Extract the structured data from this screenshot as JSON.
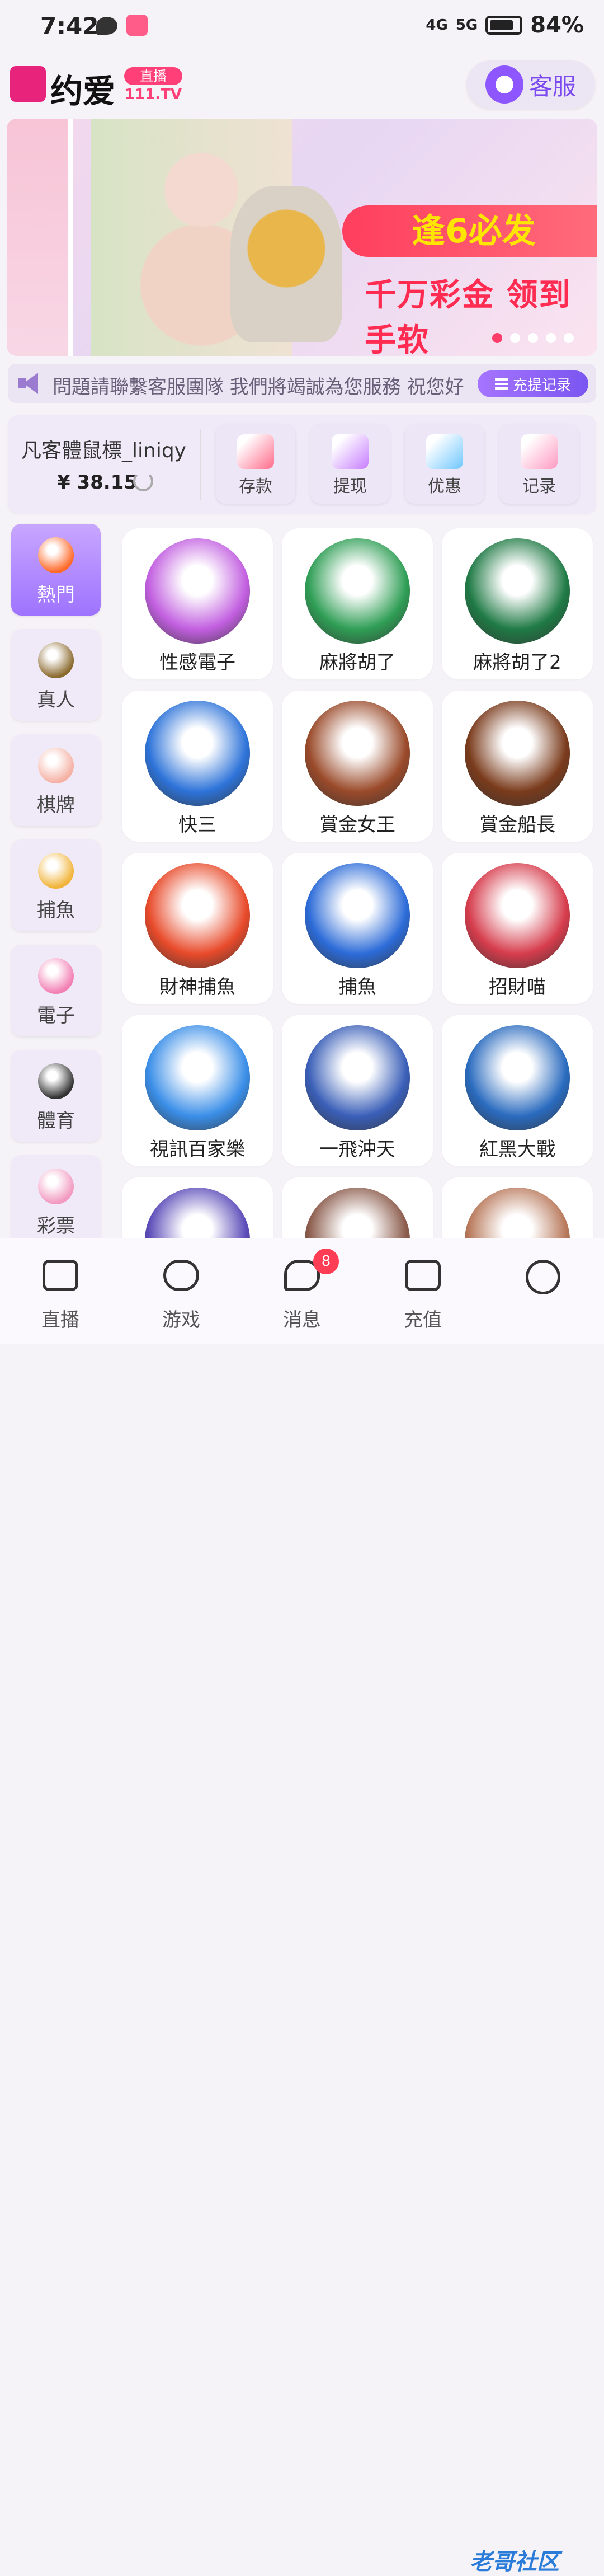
{
  "status_bar": {
    "time": "7:42",
    "net1": "4G",
    "net2": "5G",
    "battery": "84%"
  },
  "header": {
    "logo_text": "约爱",
    "live_badge": "直播",
    "domain_badge": "111.TV",
    "service_label": "客服"
  },
  "banner": {
    "title": "逢6必发",
    "subtitle": "千万彩金 领到手软",
    "active_dot": 0,
    "dot_count": 5
  },
  "marquee": {
    "text": "問題請聯繫客服團隊 我們將竭誠為您服務 祝您好",
    "record_label": "充提记录"
  },
  "account": {
    "username": "凡客體鼠標_liniqy",
    "balance": "¥ 38.15",
    "actions": [
      {
        "label": "存款",
        "color": "#ff6b8a"
      },
      {
        "label": "提现",
        "color": "#c77dff"
      },
      {
        "label": "优惠",
        "color": "#6fc7ff"
      },
      {
        "label": "记录",
        "color": "#ff9ac1"
      }
    ]
  },
  "categories": [
    {
      "label": "熱門",
      "color": "#ff6a2a",
      "active": true
    },
    {
      "label": "真人",
      "color": "#8b6a2e",
      "active": false
    },
    {
      "label": "棋牌",
      "color": "#f5b1a4",
      "active": false
    },
    {
      "label": "捕魚",
      "color": "#f1b43a",
      "active": false
    },
    {
      "label": "電子",
      "color": "#f27fb3",
      "active": false
    },
    {
      "label": "體育",
      "color": "#333333",
      "active": false
    },
    {
      "label": "彩票",
      "color": "#f29ac0",
      "active": false
    }
  ],
  "games": [
    {
      "label": "性感電子",
      "color": "#c25fe0"
    },
    {
      "label": "麻將胡了",
      "color": "#2f9e55"
    },
    {
      "label": "麻將胡了2",
      "color": "#1f7a45"
    },
    {
      "label": "快三",
      "color": "#2d73d9"
    },
    {
      "label": "賞金女王",
      "color": "#9a4a2a"
    },
    {
      "label": "賞金船長",
      "color": "#7a3b1c"
    },
    {
      "label": "財神捕魚",
      "color": "#e84a2a"
    },
    {
      "label": "捕魚",
      "color": "#2c6bd8"
    },
    {
      "label": "招財喵",
      "color": "#d63c4c"
    },
    {
      "label": "視訊百家樂",
      "color": "#3a8ee8"
    },
    {
      "label": "一飛沖天",
      "color": "#3a5fb8"
    },
    {
      "label": "紅黑大戰",
      "color": "#2a6bbf"
    },
    {
      "label": "",
      "color": "#5a4ab8"
    },
    {
      "label": "",
      "color": "#8a5a4a"
    },
    {
      "label": "",
      "color": "#b8785a"
    }
  ],
  "bottom_nav": [
    {
      "label": "直播"
    },
    {
      "label": "游戏"
    },
    {
      "label": "消息",
      "badge": "8"
    },
    {
      "label": "充值"
    },
    {
      "label": ""
    }
  ],
  "watermark": "老哥社区"
}
